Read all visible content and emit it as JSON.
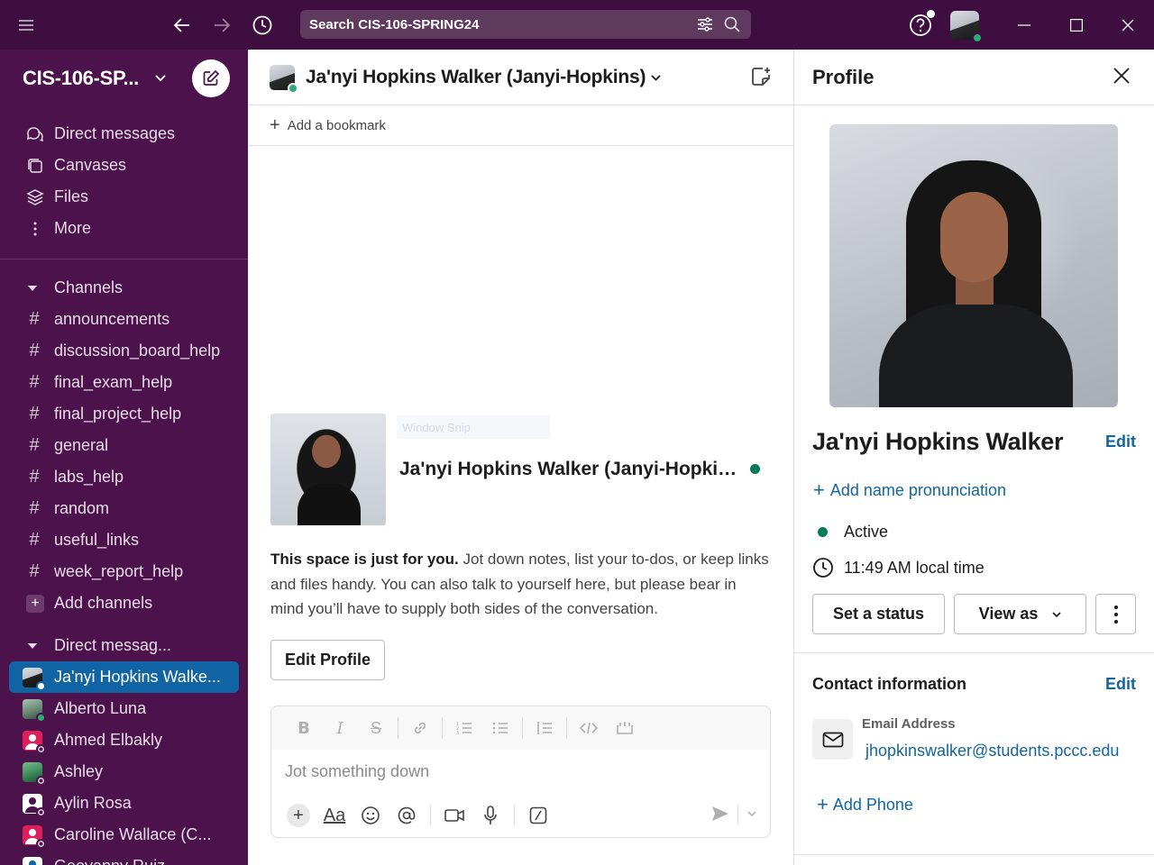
{
  "titlebar": {
    "search_placeholder": "Search CIS-106-SPRING24",
    "icons": [
      "menu-icon",
      "back-arrow-icon",
      "forward-arrow-icon",
      "history-clock-icon",
      "filter-sliders-icon",
      "search-icon",
      "help-icon",
      "minimize-icon",
      "maximize-icon",
      "close-icon"
    ]
  },
  "sidebar": {
    "workspace_name": "CIS-106-SP...",
    "nav": [
      {
        "label": "Direct messages",
        "icon": "direct-messages-icon"
      },
      {
        "label": "Canvases",
        "icon": "canvases-icon"
      },
      {
        "label": "Files",
        "icon": "files-icon"
      },
      {
        "label": "More",
        "icon": "more-vertical-icon"
      }
    ],
    "channels_header": "Channels",
    "channels": [
      "announcements",
      "discussion_board_help",
      "final_exam_help",
      "final_project_help",
      "general",
      "labs_help",
      "random",
      "useful_links",
      "week_report_help"
    ],
    "add_channels": "Add channels",
    "dm_header": "Direct messag...",
    "dms": [
      {
        "name": "Ja'nyi Hopkins Walke...",
        "status": "away",
        "avatar_color": "#c9cdd2",
        "active": true
      },
      {
        "name": "Alberto Luna",
        "status": "online",
        "avatar_color": "#6f8f7a"
      },
      {
        "name": "Ahmed Elbakly",
        "status": "away",
        "avatar_color": "#e01e5a"
      },
      {
        "name": "Ashley",
        "status": "away",
        "avatar_color": "#3e8e5b"
      },
      {
        "name": "Aylin Rosa",
        "status": "away",
        "avatar_color": "#ffffff"
      },
      {
        "name": "Caroline Wallace (C...",
        "status": "away",
        "avatar_color": "#e01e5a"
      },
      {
        "name": "Geovanny Ruiz",
        "status": "away",
        "avatar_color": "#1164a3"
      }
    ]
  },
  "main": {
    "header_title": "Ja'nyi Hopkins Walker (Janyi-Hopkins)",
    "bookmark_label": "Add a bookmark",
    "intro_name": "Ja'nyi Hopkins Walker (Janyi-Hopkins)",
    "snip_ghost": "Window Snip",
    "intro_bold": "This space is just for you.",
    "intro_rest": " Jot down notes, list your to-dos, or keep links and files handy. You can also talk to yourself here, but please bear in mind you’ll have to supply both sides of the conversation.",
    "edit_profile_label": "Edit Profile",
    "composer_placeholder": "Jot something down"
  },
  "profile": {
    "title": "Profile",
    "name": "Ja'nyi Hopkins Walker",
    "edit_label": "Edit",
    "add_pronunciation": "Add name pronunciation",
    "status": "Active",
    "local_time": "11:49 AM local time",
    "set_status_label": "Set a status",
    "view_as_label": "View as",
    "contact_title": "Contact information",
    "contact_edit_label": "Edit",
    "email_label": "Email Address",
    "email_value": "jhopkinswalker@students.pccc.edu",
    "add_phone": "Add Phone"
  },
  "colors": {
    "titlebar": "#3f0e40",
    "sidebar": "#4b124c",
    "active_item": "#1164a3",
    "link": "#1264a3",
    "online": "#2bac76"
  }
}
